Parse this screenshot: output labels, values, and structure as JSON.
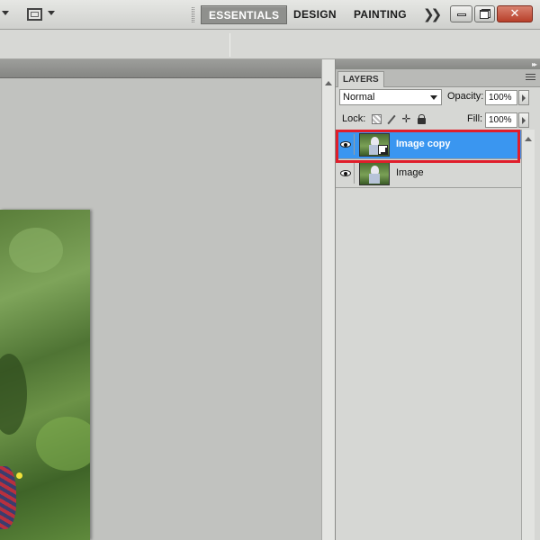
{
  "menubar": {
    "workspaces": [
      {
        "label": "ESSENTIALS",
        "active": true
      },
      {
        "label": "DESIGN",
        "active": false
      },
      {
        "label": "PAINTING",
        "active": false
      }
    ],
    "more_icon": "double-chevron-right-icon",
    "window_controls": [
      "minimize-icon",
      "restore-icon",
      "close-icon"
    ],
    "close_glyph": "✕"
  },
  "layers_panel": {
    "tab_label": "LAYERS",
    "blend_mode": "Normal",
    "opacity_label": "Opacity:",
    "opacity_value": "100%",
    "lock_label": "Lock:",
    "fill_label": "Fill:",
    "fill_value": "100%",
    "layers": [
      {
        "name": "Image copy",
        "selected": true,
        "visible": true,
        "smart_object": true
      },
      {
        "name": "Image",
        "selected": false,
        "visible": true,
        "smart_object": false
      }
    ]
  },
  "colors": {
    "selection_blue": "#3a96f0",
    "highlight_red": "#e01e2b",
    "active_workspace": "#8f908d"
  }
}
